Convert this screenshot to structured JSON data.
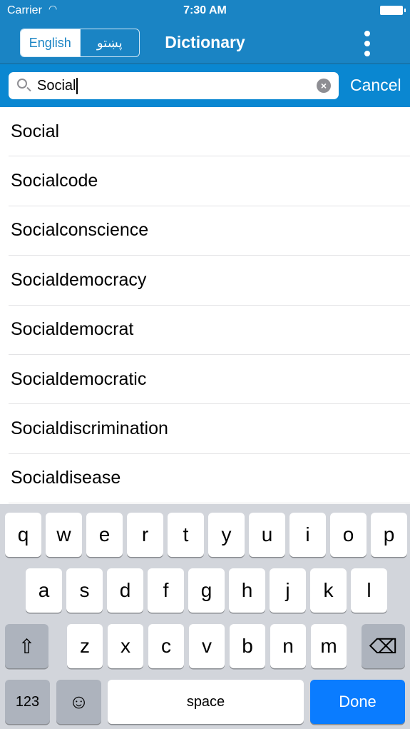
{
  "status": {
    "carrier": "Carrier",
    "time": "7:30 AM"
  },
  "nav": {
    "lang_english": "English",
    "lang_pashto": "پښتو",
    "title": "Dictionary"
  },
  "search": {
    "value": "Social",
    "cancel": "Cancel"
  },
  "results": [
    "Social",
    "Socialcode",
    "Socialconscience",
    "Socialdemocracy",
    "Socialdemocrat",
    "Socialdemocratic",
    "Socialdiscrimination",
    "Socialdisease"
  ],
  "keyboard": {
    "row1": [
      "q",
      "w",
      "e",
      "r",
      "t",
      "y",
      "u",
      "i",
      "o",
      "p"
    ],
    "row2": [
      "a",
      "s",
      "d",
      "f",
      "g",
      "h",
      "j",
      "k",
      "l"
    ],
    "row3": [
      "z",
      "x",
      "c",
      "v",
      "b",
      "n",
      "m"
    ],
    "numbers": "123",
    "space": "space",
    "done": "Done"
  },
  "colors": {
    "header": "#1a84c4",
    "search_bar": "#0a87d1",
    "done": "#0a7cff"
  }
}
